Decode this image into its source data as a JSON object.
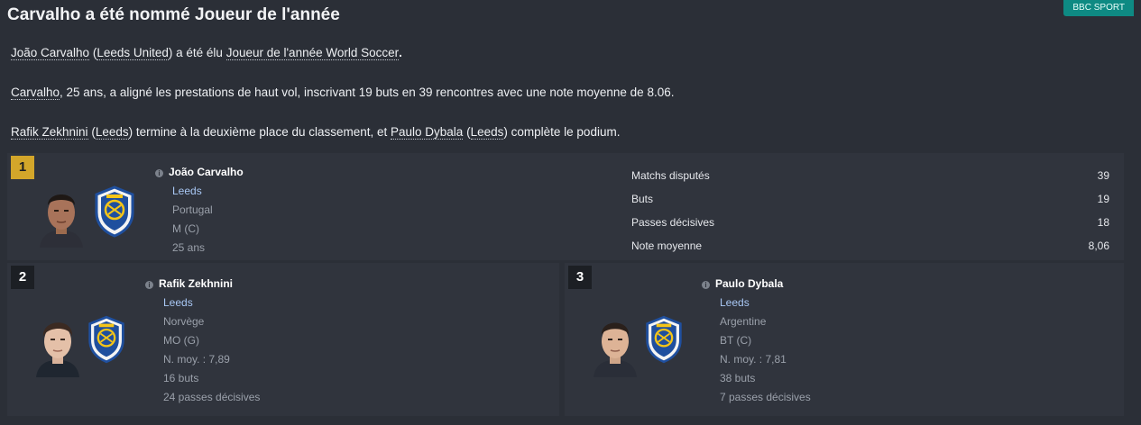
{
  "header": {
    "title": "Carvalho a été nommé Joueur de l'année",
    "source": "BBC SPORT"
  },
  "article": {
    "p1": {
      "player": "João Carvalho",
      "club": "Leeds United",
      "mid": " a été élu ",
      "award": "Joueur de l'année World Soccer",
      "end": "."
    },
    "p2": {
      "player": "Carvalho",
      "text": ", 25 ans, a aligné les prestations de haut vol, inscrivant 19 buts en 39 rencontres avec une note moyenne de 8.06."
    },
    "p3": {
      "second": "Rafik Zekhnini",
      "second_club": "Leeds",
      "mid": " termine à la deuxième place du classement, et ",
      "third": "Paulo Dybala",
      "third_club": "Leeds",
      "end": " complète le podium."
    }
  },
  "winner": {
    "rank": "1",
    "name": "João Carvalho",
    "club": "Leeds",
    "nationality": "Portugal",
    "position": "M (C)",
    "age": "25 ans",
    "stats": [
      {
        "label": "Matchs disputés",
        "value": "39"
      },
      {
        "label": "Buts",
        "value": "19"
      },
      {
        "label": "Passes décisives",
        "value": "18"
      },
      {
        "label": "Note moyenne",
        "value": "8,06"
      }
    ]
  },
  "second": {
    "rank": "2",
    "name": "Rafik Zekhnini",
    "club": "Leeds",
    "nationality": "Norvège",
    "position": "MO (G)",
    "rating": "N. moy. : 7,89",
    "goals": "16 buts",
    "assists": "24 passes décisives"
  },
  "third": {
    "rank": "3",
    "name": "Paulo Dybala",
    "club": "Leeds",
    "nationality": "Argentine",
    "position": "BT (C)",
    "rating": "N. moy. : 7,81",
    "goals": "38 buts",
    "assists": "7 passes décisives"
  },
  "colors": {
    "gold": "#d3a62a",
    "club_link": "#a9c8f5",
    "source_tag": "#0e8a83"
  }
}
